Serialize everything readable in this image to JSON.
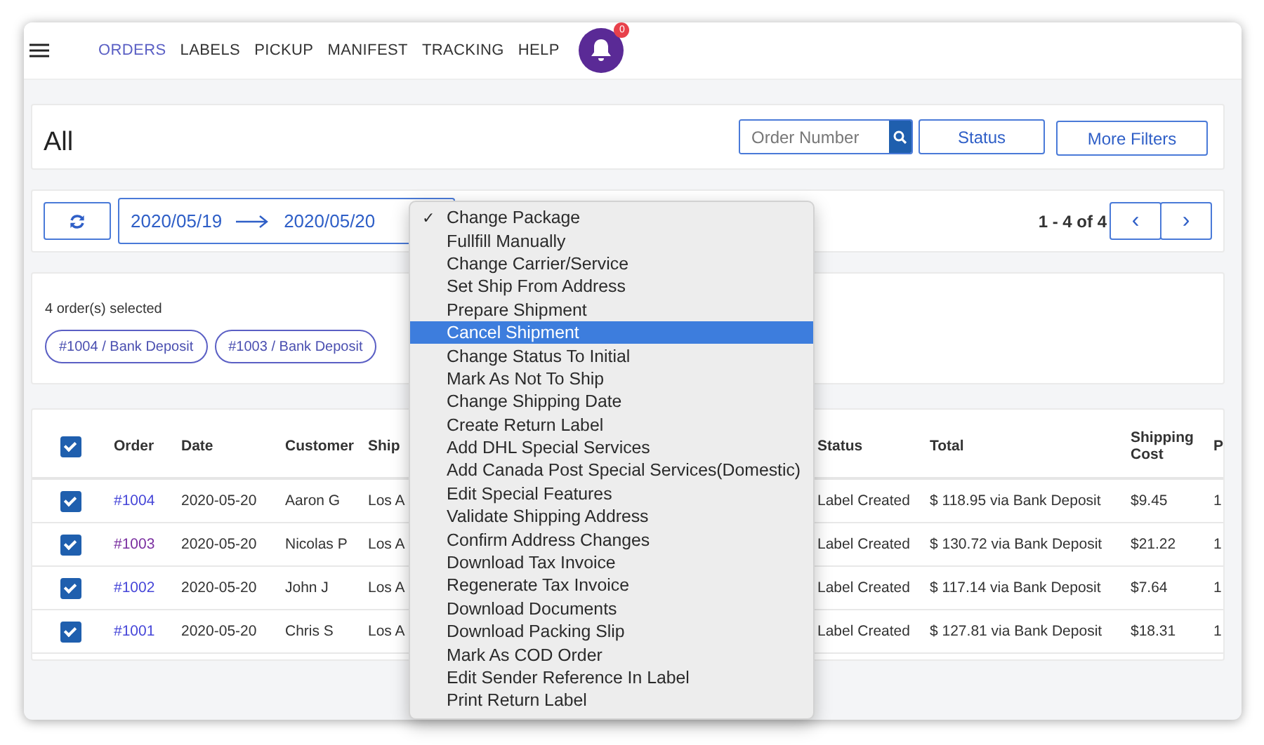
{
  "nav": {
    "items": [
      {
        "label": "ORDERS",
        "selected": true
      },
      {
        "label": "LABELS",
        "selected": false
      },
      {
        "label": "PICKUP",
        "selected": false
      },
      {
        "label": "MANIFEST",
        "selected": false
      },
      {
        "label": "TRACKING",
        "selected": false
      },
      {
        "label": "HELP",
        "selected": false
      }
    ],
    "notification_count": "0"
  },
  "header": {
    "title": "All",
    "search": {
      "placeholder": "Order Number"
    },
    "buttons": [
      "Status",
      "More Filters"
    ]
  },
  "toolbar": {
    "date_from": "2020/05/19",
    "date_to": "2020/05/20",
    "pager": "1 - 4 of 4",
    "prev": "‹",
    "next": "›"
  },
  "selection": {
    "summary": "4 order(s) selected",
    "chips": [
      "#1004 / Bank Deposit",
      "#1003 / Bank Deposit"
    ]
  },
  "table": {
    "all_checked": true,
    "columns": [
      "Order",
      "Date",
      "Customer",
      "Ship",
      "",
      "Status",
      "Total",
      "Shipping Cost",
      "P"
    ],
    "rows": [
      {
        "checked": true,
        "visited": false,
        "cells": [
          "#1004",
          "2020-05-20",
          "Aaron G",
          "Los A",
          "",
          "Label Created",
          "$ 118.95 via Bank Deposit",
          "$9.45",
          "1"
        ]
      },
      {
        "checked": true,
        "visited": true,
        "cells": [
          "#1003",
          "2020-05-20",
          "Nicolas P",
          "Los A",
          "",
          "Label Created",
          "$ 130.72 via Bank Deposit",
          "$21.22",
          "1"
        ]
      },
      {
        "checked": true,
        "visited": false,
        "cells": [
          "#1002",
          "2020-05-20",
          "John J",
          "Los A",
          "",
          "Label Created",
          "$ 117.14 via Bank Deposit",
          "$7.64",
          "1"
        ]
      },
      {
        "checked": true,
        "visited": false,
        "cells": [
          "#1001",
          "2020-05-20",
          "Chris S",
          "Los A",
          "",
          "Label Created",
          "$ 127.81 via Bank Deposit",
          "$18.31",
          "1"
        ]
      }
    ]
  },
  "menu": {
    "check_mark": "✓",
    "items": [
      {
        "label": "Change Package",
        "checked": true,
        "selected": false
      },
      {
        "label": "Fullfill Manually",
        "checked": false,
        "selected": false
      },
      {
        "label": "Change Carrier/Service",
        "checked": false,
        "selected": false
      },
      {
        "label": "Set Ship From Address",
        "checked": false,
        "selected": false
      },
      {
        "label": "Prepare Shipment",
        "checked": false,
        "selected": false
      },
      {
        "label": "Cancel Shipment",
        "checked": false,
        "selected": true
      },
      {
        "label": "Change Status To Initial",
        "checked": false,
        "selected": false
      },
      {
        "label": "Mark As Not To Ship",
        "checked": false,
        "selected": false
      },
      {
        "label": "Change Shipping Date",
        "checked": false,
        "selected": false
      },
      {
        "label": "Create Return Label",
        "checked": false,
        "selected": false
      },
      {
        "label": "Add DHL Special Services",
        "checked": false,
        "selected": false
      },
      {
        "label": "Add Canada Post Special Services(Domestic)",
        "checked": false,
        "selected": false
      },
      {
        "label": "Edit Special Features",
        "checked": false,
        "selected": false
      },
      {
        "label": "Validate Shipping Address",
        "checked": false,
        "selected": false
      },
      {
        "label": "Confirm Address Changes",
        "checked": false,
        "selected": false
      },
      {
        "label": "Download Tax Invoice",
        "checked": false,
        "selected": false
      },
      {
        "label": "Regenerate Tax Invoice",
        "checked": false,
        "selected": false
      },
      {
        "label": "Download Documents",
        "checked": false,
        "selected": false
      },
      {
        "label": "Download Packing Slip",
        "checked": false,
        "selected": false
      },
      {
        "label": "Mark As COD Order",
        "checked": false,
        "selected": false
      },
      {
        "label": "Edit Sender Reference In Label",
        "checked": false,
        "selected": false
      },
      {
        "label": "Print Return Label",
        "checked": false,
        "selected": false
      }
    ]
  }
}
